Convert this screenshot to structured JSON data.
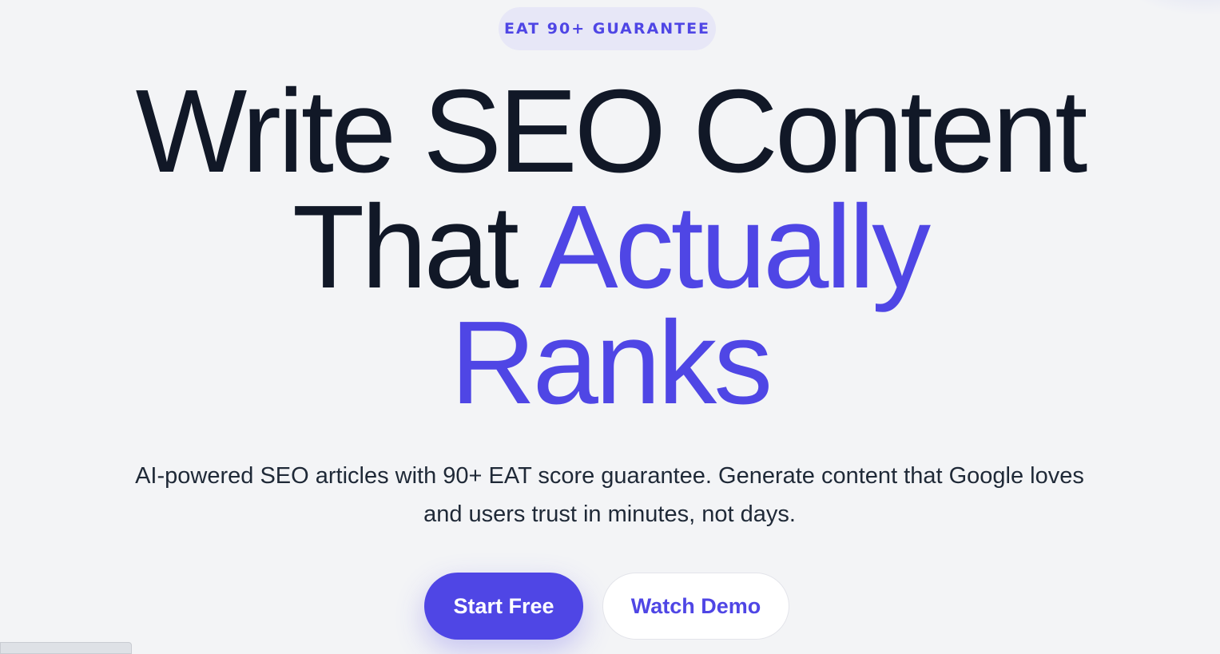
{
  "hero": {
    "badge": "EAT 90+ GUARANTEE",
    "headline_line1": "Write SEO Content",
    "headline_line2_plain": "That ",
    "headline_line2_accent": "Actually",
    "headline_line3_accent": "Ranks",
    "subtitle": "AI-powered SEO articles with 90+ EAT score guarantee. Generate content that Google loves and users trust in minutes, not days.",
    "primary_cta": "Start Free",
    "secondary_cta": "Watch Demo"
  },
  "statusbar": {
    "url": "..."
  },
  "colors": {
    "accent": "#4f46e5",
    "text_dark": "#111827",
    "background": "#f3f4f6",
    "badge_bg": "#e7e7f7"
  }
}
